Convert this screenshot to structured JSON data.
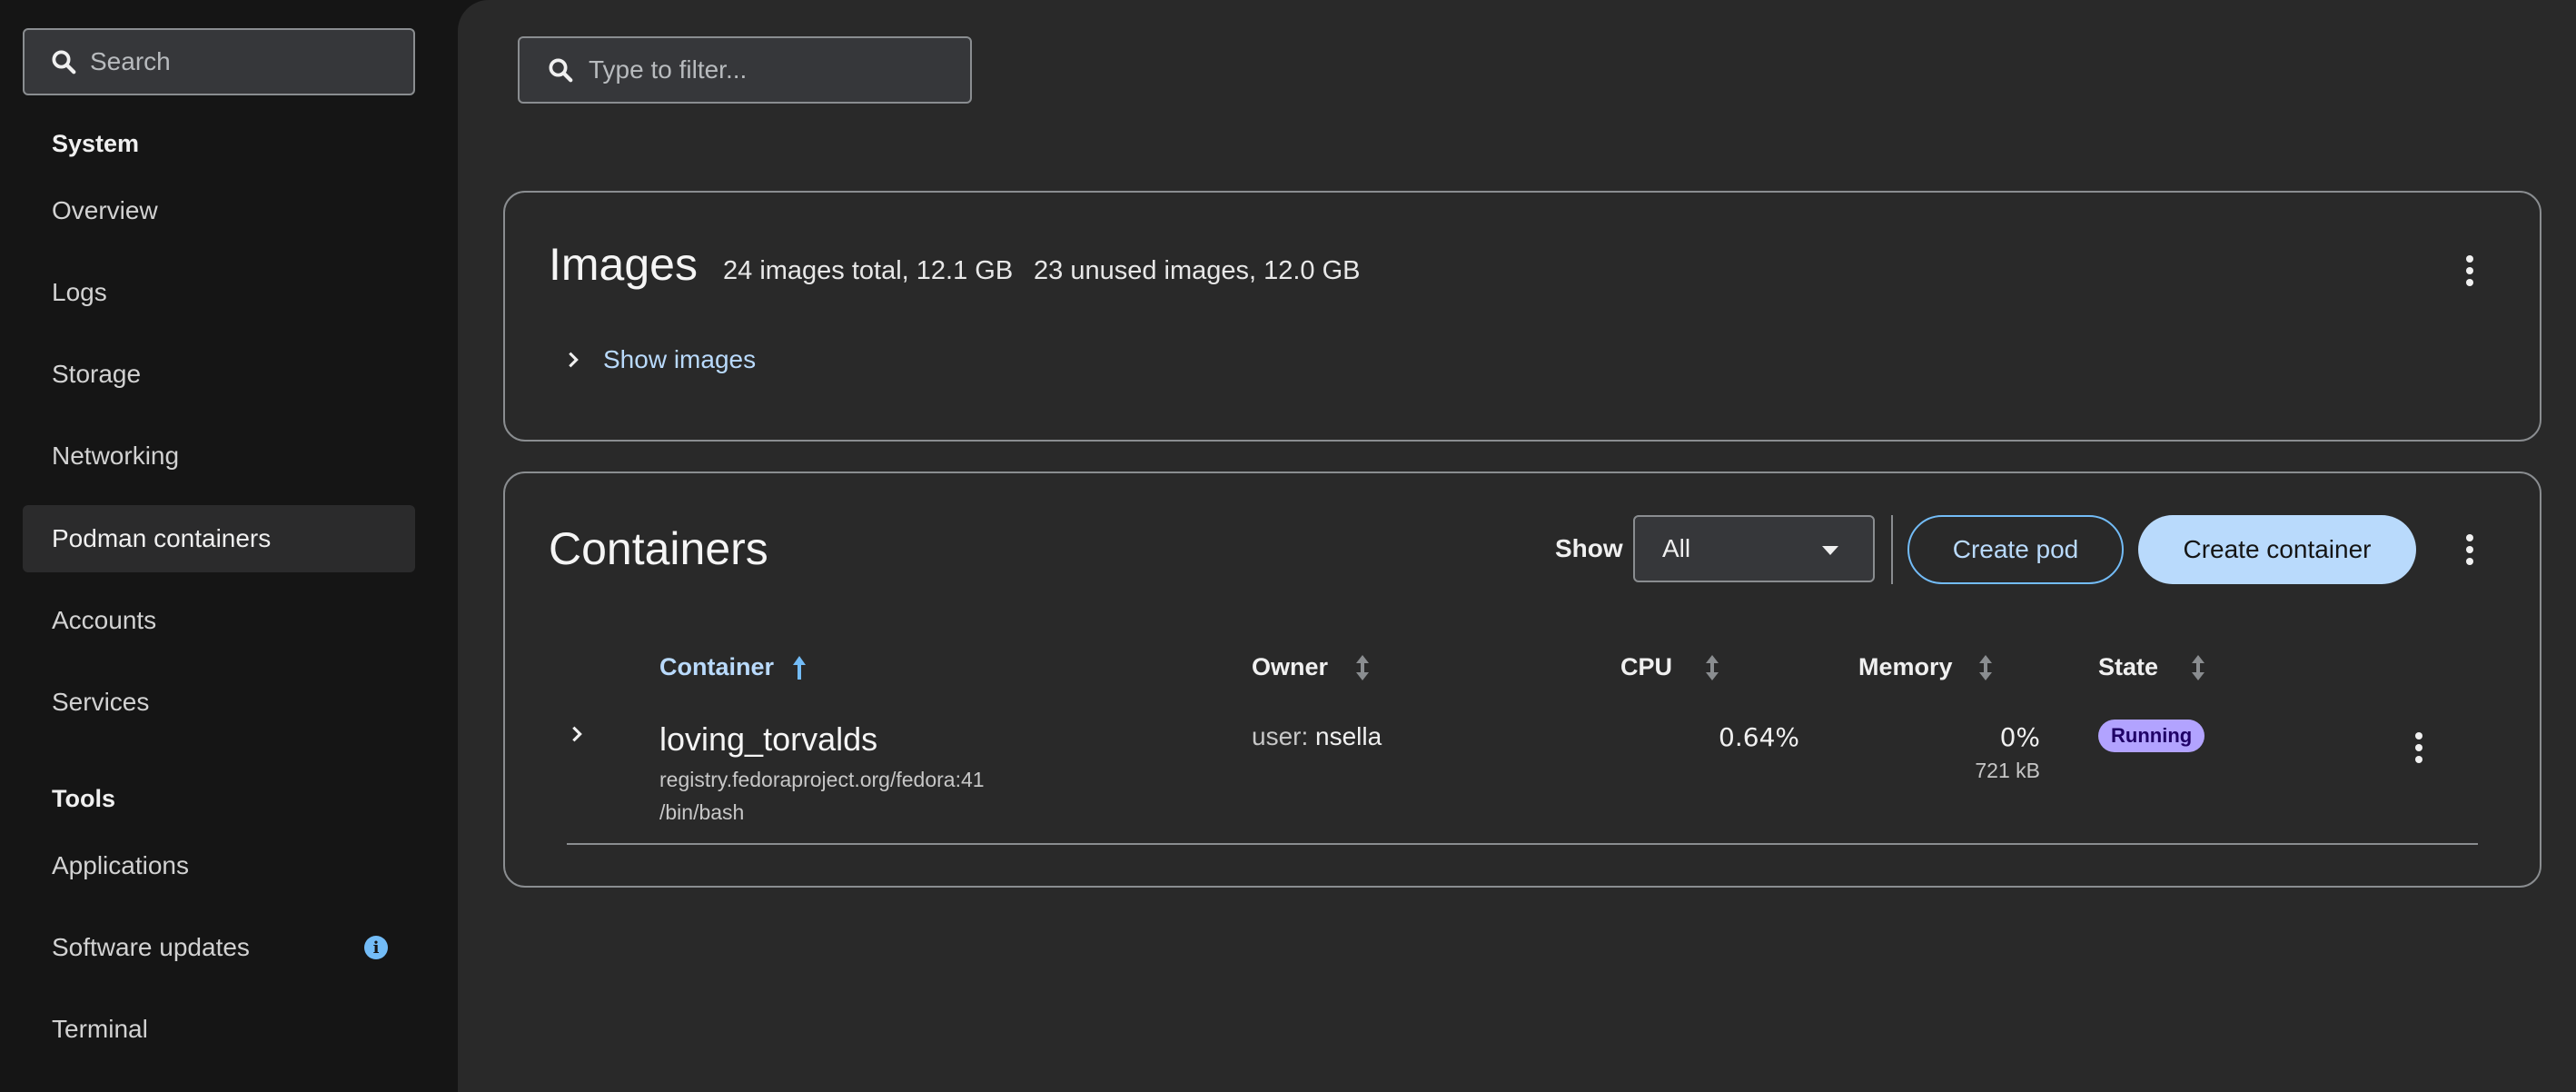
{
  "sidebar": {
    "search_placeholder": "Search",
    "sections": [
      {
        "title": "System",
        "items": [
          {
            "label": "Overview"
          },
          {
            "label": "Logs"
          },
          {
            "label": "Storage"
          },
          {
            "label": "Networking"
          },
          {
            "label": "Podman containers",
            "active": true
          },
          {
            "label": "Accounts"
          },
          {
            "label": "Services"
          }
        ]
      },
      {
        "title": "Tools",
        "items": [
          {
            "label": "Applications"
          },
          {
            "label": "Software updates",
            "badge_icon": "info-icon"
          },
          {
            "label": "Terminal"
          }
        ]
      }
    ]
  },
  "filter": {
    "placeholder": "Type to filter..."
  },
  "images_card": {
    "title": "Images",
    "total": "24 images total, 12.1 GB",
    "unused": "23 unused images, 12.0 GB",
    "toggle_label": "Show images"
  },
  "containers_card": {
    "title": "Containers",
    "show_label": "Show",
    "show_select_value": "All",
    "create_pod_label": "Create pod",
    "create_container_label": "Create container",
    "columns": {
      "container": "Container",
      "owner": "Owner",
      "cpu": "CPU",
      "memory": "Memory",
      "state": "State"
    },
    "rows": [
      {
        "name": "loving_torvalds",
        "image": "registry.fedoraproject.org/fedora:41",
        "command": "/bin/bash",
        "owner_prefix": "user:",
        "owner_name": "nsella",
        "cpu": "0.64%",
        "memory_percent": "0%",
        "memory_used": "721 kB",
        "state": "Running"
      }
    ]
  },
  "colors": {
    "page_bg": "#151515",
    "main_bg": "#292929",
    "link": "#b9dafc",
    "primary_button": "#b9dafc",
    "running_badge": "#b2a3ff",
    "info_icon": "#73bcf7"
  }
}
